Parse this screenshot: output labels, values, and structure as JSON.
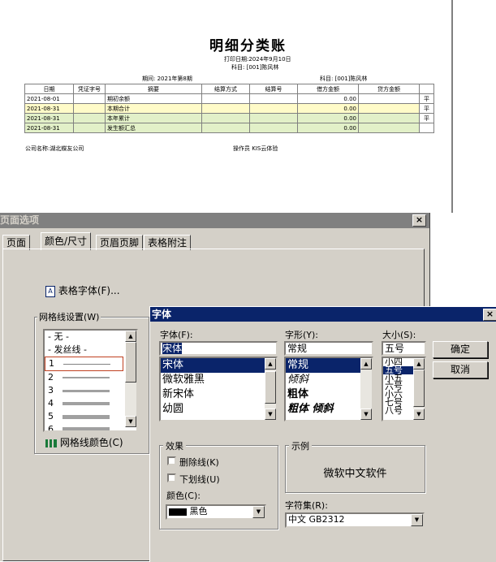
{
  "report": {
    "title": "明细分类账",
    "print_date": "打印日期:2024年9月10日",
    "subject_top": "科目: [001]陈风林",
    "period": "期间: 2021年第8期",
    "subject_right": "科目: [001]陈风林",
    "columns": [
      "日期",
      "凭证字号",
      "摘要",
      "结算方式",
      "结算号",
      "借方金额",
      "贷方金额",
      ""
    ],
    "rows": [
      {
        "date": "2021-08-01",
        "voucher": "",
        "summary": "期初余额",
        "method": "",
        "no": "",
        "debit": "0.00",
        "credit": "",
        "flag": "平"
      },
      {
        "date": "2021-08-31",
        "voucher": "",
        "summary": "本期合计",
        "method": "",
        "no": "",
        "debit": "0.00",
        "credit": "",
        "flag": "平"
      },
      {
        "date": "2021-08-31",
        "voucher": "",
        "summary": "本年累计",
        "method": "",
        "no": "",
        "debit": "0.00",
        "credit": "",
        "flag": "平"
      },
      {
        "date": "2021-08-31",
        "voucher": "",
        "summary": "发生额汇总",
        "method": "",
        "no": "",
        "debit": "0.00",
        "credit": "",
        "flag": ""
      }
    ],
    "company": "公司名称:湖北蝶友公司",
    "operator": "操作员 KIS云体验"
  },
  "page_dialog": {
    "title": "页面选项",
    "close": "×",
    "tabs": [
      "页面",
      "颜色/尺寸",
      "页眉页脚",
      "表格附注"
    ],
    "table_font_btn": "表格字体(F)...",
    "grid_group": "网格线设置(W)",
    "grid_items": [
      "- 无 -",
      "- 发丝线 -",
      "1",
      "2",
      "3",
      "4",
      "5",
      "6"
    ],
    "grid_color_btn": "网格线颜色(C)"
  },
  "font_dialog": {
    "title": "字体",
    "close": "×",
    "font_label": "字体(F):",
    "font_value": "宋体",
    "font_list": [
      "宋体",
      "微软雅黑",
      "新宋体",
      "幼圆"
    ],
    "style_label": "字形(Y):",
    "style_value": "常规",
    "style_list": [
      "常规",
      "倾斜",
      "粗体",
      "粗体 倾斜"
    ],
    "size_label": "大小(S):",
    "size_value": "五号",
    "size_list": [
      "小四",
      "五号",
      "小五",
      "六号",
      "小六",
      "七号",
      "八号"
    ],
    "ok": "确定",
    "cancel": "取消",
    "effects_label": "效果",
    "strike": "删除线(K)",
    "underline": "下划线(U)",
    "color_label": "颜色(C):",
    "color_value": "黑色",
    "sample_label": "示例",
    "sample_text": "微软中文软件",
    "charset_label": "字符集(R):",
    "charset_value": "中文 GB2312"
  }
}
